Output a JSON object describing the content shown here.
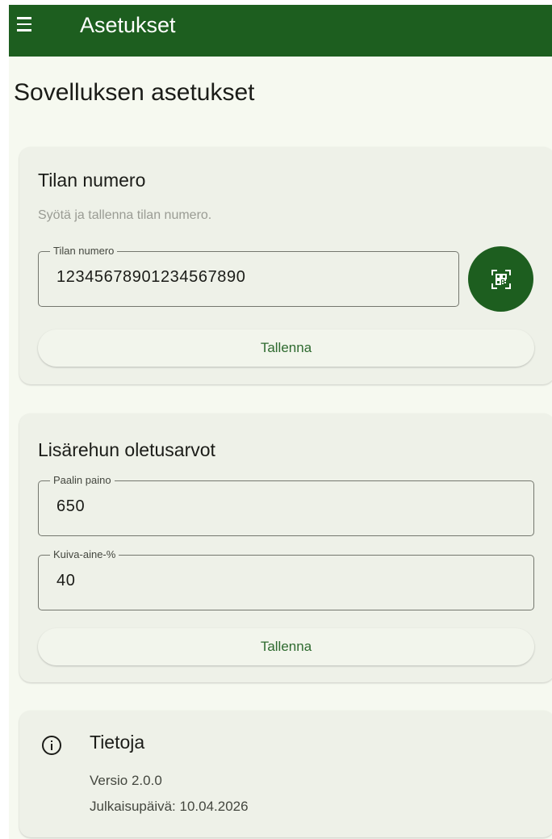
{
  "app_bar": {
    "menu_icon": "hamburger-menu-icon",
    "title": "Asetukset"
  },
  "page_title": "Sovelluksen asetukset",
  "farm_card": {
    "title": "Tilan numero",
    "description": "Syötä ja tallenna tilan numero.",
    "field": {
      "label": "Tilan numero",
      "value": "12345678901234567890"
    },
    "scan_icon": "qr-code-scanner-icon",
    "save_label": "Tallenna"
  },
  "feed_card": {
    "title": "Lisärehun oletusarvot",
    "bale_weight": {
      "label": "Paalin paino",
      "value": "650"
    },
    "dry_matter": {
      "label": "Kuiva-aine-%",
      "value": "40"
    },
    "save_label": "Tallenna"
  },
  "info_card": {
    "icon": "info-icon",
    "title": "Tietoja",
    "version": "Versio 2.0.0",
    "release_date": "Julkaisupäivä: 10.04.2026"
  },
  "colors": {
    "primary": "#1d5e1f",
    "background": "#f6f9f0",
    "card": "#eef1e8",
    "button_text": "#2e6a2f"
  }
}
